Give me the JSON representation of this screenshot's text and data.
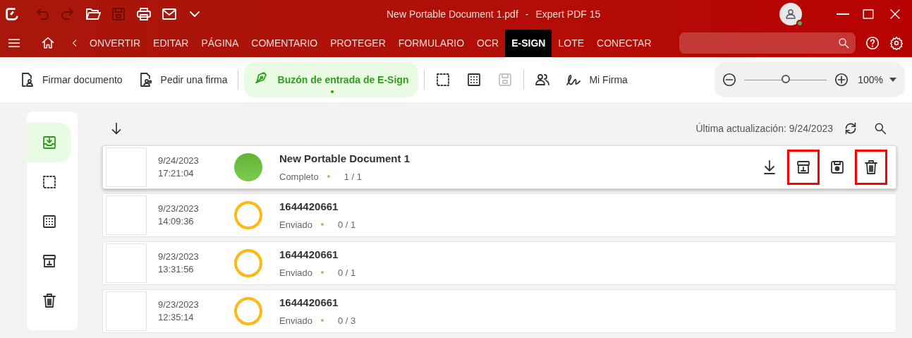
{
  "title_bar": {
    "document": "New Portable Document 1.pdf",
    "separator": "-",
    "app": "Expert PDF 15",
    "quick_actions": [
      {
        "kind": "undo",
        "disabled": true
      },
      {
        "kind": "redo",
        "disabled": true
      },
      {
        "kind": "open",
        "disabled": false
      },
      {
        "kind": "save",
        "disabled": true
      },
      {
        "kind": "print",
        "disabled": false
      },
      {
        "kind": "mail",
        "disabled": false
      },
      {
        "kind": "more",
        "disabled": false
      }
    ],
    "account": {
      "online": true
    }
  },
  "menu": {
    "tabs": [
      {
        "label": "ONVERTIR",
        "selected": false
      },
      {
        "label": "EDITAR",
        "selected": false
      },
      {
        "label": "PÁGINA",
        "selected": false
      },
      {
        "label": "COMENTARIO",
        "selected": false
      },
      {
        "label": "PROTEGER",
        "selected": false
      },
      {
        "label": "FORMULARIO",
        "selected": false
      },
      {
        "label": "OCR",
        "selected": false
      },
      {
        "label": "E-SIGN",
        "selected": true
      },
      {
        "label": "LOTE",
        "selected": false
      },
      {
        "label": "CONECTAR",
        "selected": false
      }
    ]
  },
  "toolbar": {
    "items": [
      {
        "kind": "sign",
        "label": "Firmar documento",
        "selected": false,
        "disabled": false
      },
      {
        "kind": "request",
        "label": "Pedir una firma",
        "selected": false,
        "disabled": false
      },
      {
        "kind": "separator"
      },
      {
        "kind": "inbox",
        "label": "Buzón de entrada de E-Sign",
        "selected": true,
        "disabled": false
      },
      {
        "kind": "separator"
      },
      {
        "kind": "draft",
        "selected": false,
        "disabled": false
      },
      {
        "kind": "template",
        "selected": false,
        "disabled": false
      },
      {
        "kind": "save",
        "selected": false,
        "disabled": true
      },
      {
        "kind": "separator"
      },
      {
        "kind": "contacts",
        "selected": false,
        "disabled": false
      },
      {
        "kind": "signature",
        "label": "Mi Firma",
        "selected": false,
        "disabled": false
      }
    ],
    "zoom": {
      "level": 0.5,
      "reading": "100%"
    }
  },
  "sidebar": {
    "items": [
      {
        "kind": "inbox",
        "selected": true
      },
      {
        "kind": "draft",
        "selected": false
      },
      {
        "kind": "template",
        "selected": false
      },
      {
        "kind": "archive",
        "selected": false
      },
      {
        "kind": "delete",
        "selected": false
      }
    ]
  },
  "list": {
    "last_update": "Última actualización: 9/24/2023",
    "rows": [
      {
        "date": "9/24/2023",
        "time": "17:21:04",
        "kind": "complete",
        "title": "New Portable Document 1",
        "status": "Completo",
        "count": "1 / 1",
        "selected": true,
        "actions": [
          {
            "kind": "download",
            "highlighted": false
          },
          {
            "kind": "archive",
            "highlighted": true
          },
          {
            "kind": "save",
            "highlighted": false
          },
          {
            "kind": "delete",
            "highlighted": true
          }
        ]
      },
      {
        "date": "9/23/2023",
        "time": "14:09:36",
        "kind": "sent",
        "title": "1644420661",
        "status": "Enviado",
        "count": "0 / 1",
        "selected": false
      },
      {
        "date": "9/23/2023",
        "time": "13:31:56",
        "kind": "sent",
        "title": "1644420661",
        "status": "Enviado",
        "count": "0 / 1",
        "selected": false
      },
      {
        "date": "9/23/2023",
        "time": "12:35:14",
        "kind": "sent",
        "title": "1644420661",
        "status": "Enviado",
        "count": "0 / 3",
        "selected": false
      }
    ]
  }
}
